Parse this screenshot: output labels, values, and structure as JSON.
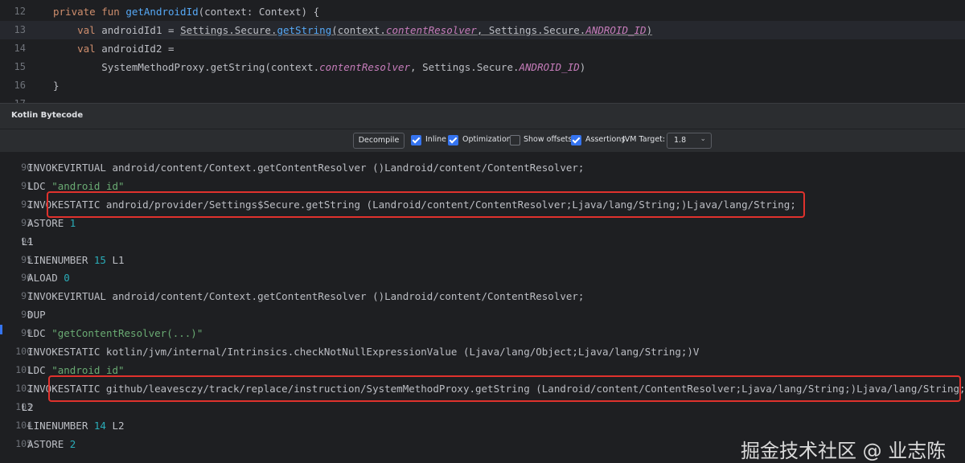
{
  "editor": {
    "lines": [
      {
        "num": "12",
        "parts": [
          [
            "kw",
            "private fun "
          ],
          [
            "fn",
            "getAndroidId"
          ],
          [
            "",
            "(context: Context) {"
          ]
        ]
      },
      {
        "num": "13",
        "current": true,
        "parts": [
          [
            "",
            "    "
          ],
          [
            "kw",
            "val "
          ],
          [
            "var",
            "androidId1 = "
          ],
          [
            "u",
            "Settings.Secure."
          ],
          [
            "u fn",
            "getString"
          ],
          [
            "u",
            "(context."
          ],
          [
            "u prop",
            "contentResolver"
          ],
          [
            "u",
            ", Settings.Secure."
          ],
          [
            "u prop",
            "ANDROID_ID"
          ],
          [
            "u",
            ")"
          ]
        ]
      },
      {
        "num": "14",
        "parts": [
          [
            "",
            "    "
          ],
          [
            "kw",
            "val "
          ],
          [
            "var",
            "androidId2 ="
          ]
        ]
      },
      {
        "num": "15",
        "parts": [
          [
            "",
            "        SystemMethodProxy.getString(context."
          ],
          [
            "prop",
            "contentResolver"
          ],
          [
            "",
            ", Settings.Secure."
          ],
          [
            "prop",
            "ANDROID_ID"
          ],
          [
            "",
            ")"
          ]
        ]
      },
      {
        "num": "16",
        "parts": [
          [
            "",
            "}"
          ]
        ]
      },
      {
        "num": "17",
        "parts": []
      }
    ]
  },
  "panel": {
    "title": "Kotlin Bytecode",
    "decompile_label": "Decompile",
    "inline_label": "Inline",
    "optimization_label": "Optimization",
    "show_offsets_label": "Show offsets",
    "assertions_label": "Assertions",
    "jvm_target_label": "JVM Target:",
    "jvm_target_value": "1.8",
    "inline_checked": true,
    "optimization_checked": true,
    "show_offsets_checked": false,
    "assertions_checked": true
  },
  "bytecode": [
    {
      "num": "90",
      "parts": [
        [
          "",
          "    INVOKEVIRTUAL android/content/Context.getContentResolver ()Landroid/content/ContentResolver;"
        ]
      ]
    },
    {
      "num": "91",
      "parts": [
        [
          "",
          "    LDC "
        ],
        [
          "str",
          "\"android_id\""
        ]
      ]
    },
    {
      "num": "92",
      "highlight": true,
      "parts": [
        [
          "",
          "    INVOKESTATIC android/provider/Settings$Secure.getString (Landroid/content/ContentResolver;Ljava/lang/String;)Ljava/lang/String;"
        ]
      ]
    },
    {
      "num": "93",
      "parts": [
        [
          "",
          "    ASTORE "
        ],
        [
          "num",
          "1"
        ]
      ]
    },
    {
      "num": "94",
      "parts": [
        [
          "",
          "   L1"
        ]
      ]
    },
    {
      "num": "95",
      "parts": [
        [
          "",
          "    LINENUMBER "
        ],
        [
          "num",
          "15"
        ],
        [
          "",
          " L1"
        ]
      ]
    },
    {
      "num": "96",
      "parts": [
        [
          "",
          "    ALOAD "
        ],
        [
          "num",
          "0"
        ]
      ]
    },
    {
      "num": "97",
      "parts": [
        [
          "",
          "    INVOKEVIRTUAL android/content/Context.getContentResolver ()Landroid/content/ContentResolver;"
        ]
      ]
    },
    {
      "num": "98",
      "parts": [
        [
          "",
          "    DUP"
        ]
      ]
    },
    {
      "num": "99",
      "parts": [
        [
          "",
          "    LDC "
        ],
        [
          "str",
          "\"getContentResolver(...)\""
        ]
      ]
    },
    {
      "num": "100",
      "parts": [
        [
          "",
          "    INVOKESTATIC kotlin/jvm/internal/Intrinsics.checkNotNullExpressionValue (Ljava/lang/Object;Ljava/lang/String;)V"
        ]
      ]
    },
    {
      "num": "101",
      "parts": [
        [
          "",
          "    LDC "
        ],
        [
          "str",
          "\"android_id\""
        ]
      ]
    },
    {
      "num": "102",
      "highlight": true,
      "parts": [
        [
          "",
          "    INVOKESTATIC github/leavesczy/track/replace/instruction/SystemMethodProxy.getString (Landroid/content/ContentResolver;Ljava/lang/String;)Ljava/lang/String;"
        ]
      ]
    },
    {
      "num": "103",
      "parts": [
        [
          "",
          "   L2"
        ]
      ]
    },
    {
      "num": "104",
      "parts": [
        [
          "",
          "    LINENUMBER "
        ],
        [
          "num",
          "14"
        ],
        [
          "",
          " L2"
        ]
      ]
    },
    {
      "num": "105",
      "parts": [
        [
          "",
          "    ASTORE "
        ],
        [
          "num",
          "2"
        ]
      ]
    }
  ],
  "watermark": "掘金技术社区 @ 业志陈"
}
